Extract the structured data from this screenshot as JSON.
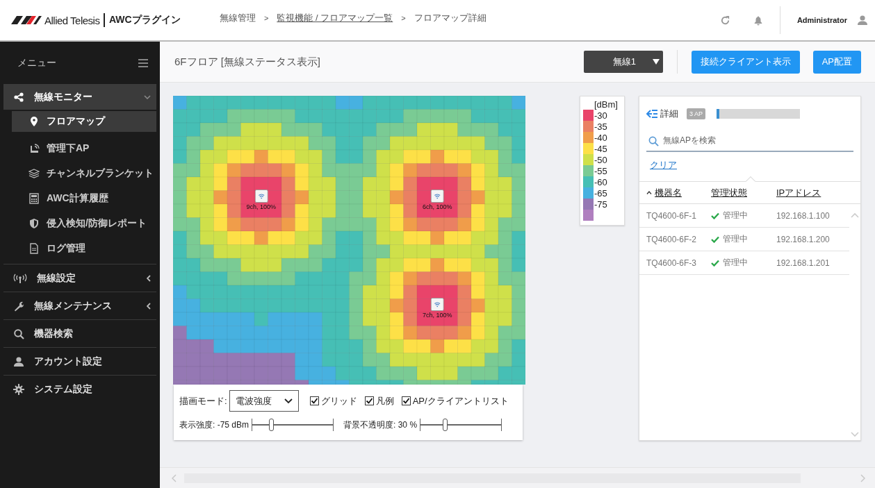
{
  "header": {
    "brand": "Allied Telesis",
    "product": "AWCプラグイン",
    "breadcrumbs": [
      {
        "label": "無線管理",
        "link": false
      },
      {
        "label": "監視機能 / フロアマップ一覧",
        "link": true
      },
      {
        "label": "フロアマップ詳細",
        "link": false
      }
    ],
    "separator": ">",
    "user": "Administrator"
  },
  "sidebar": {
    "title": "メニュー",
    "items": [
      {
        "label": "無線モニター",
        "expanded": true,
        "children": [
          {
            "label": "フロアマップ",
            "selected": true
          },
          {
            "label": "管理下AP",
            "selected": false
          },
          {
            "label": "チャンネルブランケット",
            "selected": false
          },
          {
            "label": "AWC計算履歴",
            "selected": false
          },
          {
            "label": "侵入検知/防御レポート",
            "selected": false
          },
          {
            "label": "ログ管理",
            "selected": false
          }
        ]
      },
      {
        "label": "無線設定",
        "expanded": false
      },
      {
        "label": "無線メンテナンス",
        "expanded": false
      },
      {
        "label": "機器検索"
      },
      {
        "label": "アカウント設定"
      },
      {
        "label": "システム設定"
      }
    ]
  },
  "toolbar": {
    "title": "6Fフロア [無線ステータス表示]",
    "radio_select": "無線1",
    "buttons": [
      "接続クライアント表示",
      "AP配置"
    ]
  },
  "map": {
    "access_points": [
      {
        "label": "9ch, 100%"
      },
      {
        "label": "6ch, 100%"
      },
      {
        "label": "7ch, 100%"
      }
    ],
    "controls": {
      "mode_label": "描画モード:",
      "mode_value": "電波強度",
      "checkboxes": [
        {
          "label": "グリッド",
          "checked": true
        },
        {
          "label": "凡例",
          "checked": true
        },
        {
          "label": "AP/クライアントリスト",
          "checked": true
        }
      ],
      "sliders": [
        {
          "label": "表示強度: -75 dBm",
          "level": 0.23
        },
        {
          "label": "背景不透明度: 30 %",
          "level": 0.3
        }
      ]
    }
  },
  "legend": {
    "unit": "[dBm]",
    "levels": [
      {
        "label": "-30",
        "color": "#e9446a"
      },
      {
        "label": "-35",
        "color": "#ea8063"
      },
      {
        "label": "-40",
        "color": "#f09d4a"
      },
      {
        "label": "-45",
        "color": "#fde047"
      },
      {
        "label": "-50",
        "color": "#cfe04a"
      },
      {
        "label": "-55",
        "color": "#7acb94"
      },
      {
        "label": "-60",
        "color": "#46bfb5"
      },
      {
        "label": "-65",
        "color": "#47b1e0"
      },
      {
        "label": "-75",
        "color": "#9578b4"
      },
      {
        "color": "#b07fbf"
      }
    ]
  },
  "ap_panel": {
    "title": "詳細",
    "count_badge": "3 AP",
    "progress": {
      "level": 0.03
    },
    "search": {
      "placeholder": "無線APを検索"
    },
    "clear_link": "クリア",
    "columns": [
      {
        "label": "機器名",
        "selected": true
      },
      {
        "label": "管理状態",
        "selected": false
      },
      {
        "label": "IPアドレス",
        "selected": false
      }
    ],
    "rows": [
      {
        "name": "TQ4600-6F-1",
        "status": "管理中",
        "ip": "192.168.1.100"
      },
      {
        "name": "TQ4600-6F-2",
        "status": "管理中",
        "ip": "192.168.1.200"
      },
      {
        "name": "TQ4600-6F-3",
        "status": "管理中",
        "ip": "192.168.1.201"
      }
    ]
  }
}
